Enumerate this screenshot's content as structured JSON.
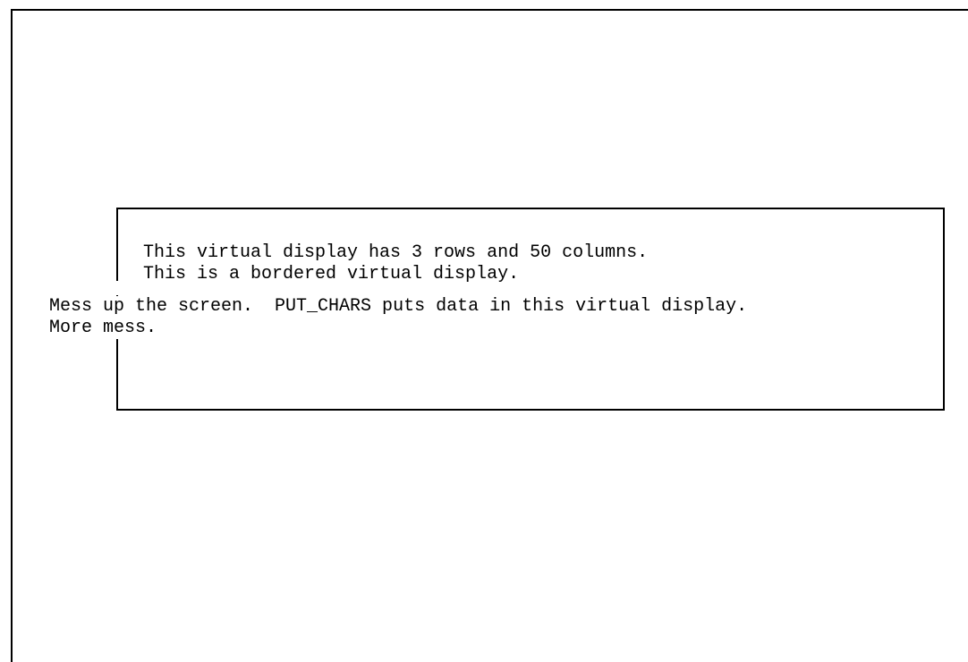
{
  "screen": {
    "display_lines": [
      "This virtual display has 3 rows and 50 columns.",
      "This is a bordered virtual display."
    ],
    "mess_lines": [
      "Mess up the screen.  PUT_CHARS puts data in this virtual display.",
      "More mess."
    ]
  }
}
